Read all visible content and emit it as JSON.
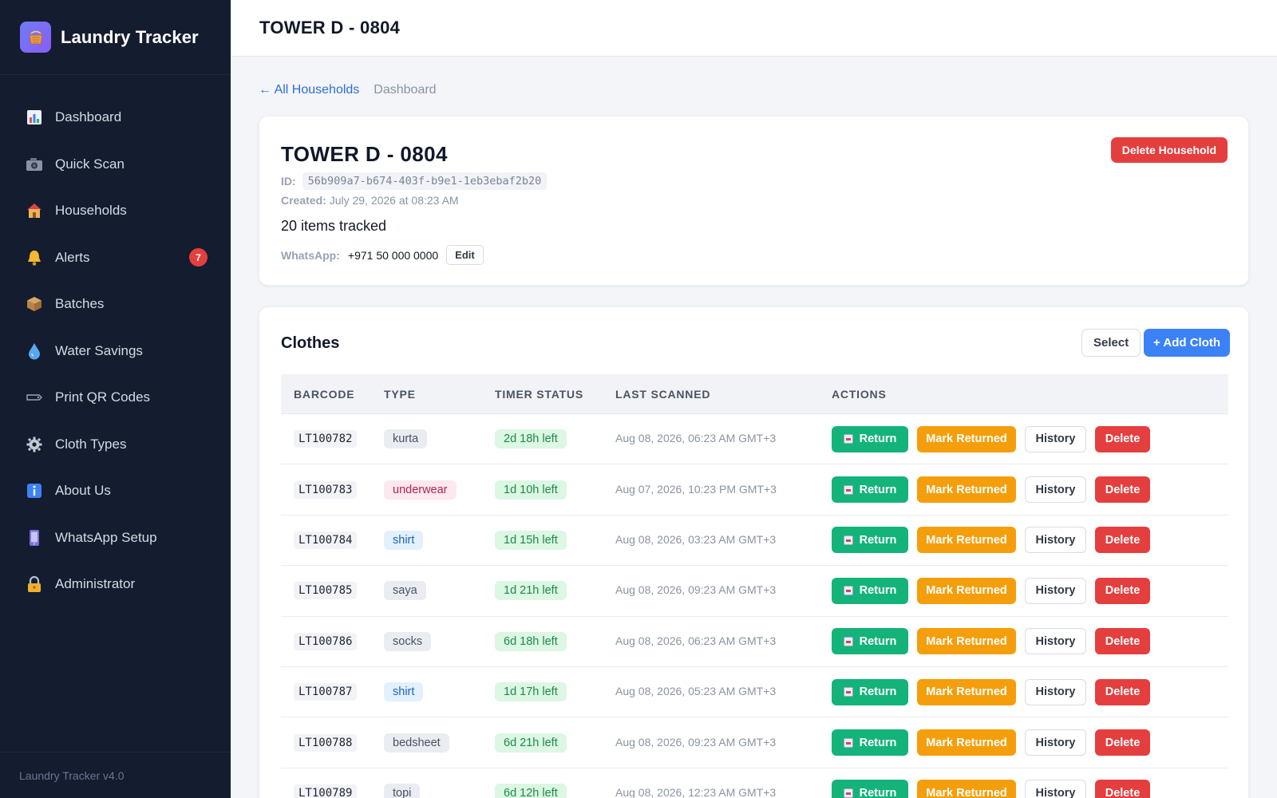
{
  "app": {
    "title": "Laundry Tracker",
    "version": "Laundry Tracker v4.0"
  },
  "sidebar": {
    "items": [
      {
        "label": "Dashboard",
        "icon": "bar-chart-icon"
      },
      {
        "label": "Quick Scan",
        "icon": "camera-icon"
      },
      {
        "label": "Households",
        "icon": "house-icon"
      },
      {
        "label": "Alerts",
        "icon": "bell-icon",
        "badge": "7"
      },
      {
        "label": "Batches",
        "icon": "package-icon"
      },
      {
        "label": "Water Savings",
        "icon": "water-drop-icon"
      },
      {
        "label": "Print QR Codes",
        "icon": "tag-icon"
      },
      {
        "label": "Cloth Types",
        "icon": "gear-icon"
      },
      {
        "label": "About Us",
        "icon": "info-icon"
      },
      {
        "label": "WhatsApp Setup",
        "icon": "phone-icon"
      },
      {
        "label": "Administrator",
        "icon": "lock-icon"
      }
    ]
  },
  "header": {
    "title": "TOWER D - 0804"
  },
  "breadcrumb": {
    "back": "← All Households",
    "current": "Dashboard"
  },
  "household": {
    "name": "TOWER D - 0804",
    "id_label": "ID:",
    "id": "56b909a7-b674-403f-b9e1-1eb3ebaf2b20",
    "created_label": "Created:",
    "created": "July 29, 2026 at 08:23 AM",
    "items_tracked": "20 items tracked",
    "whatsapp_label": "WhatsApp:",
    "whatsapp": "+971 50 000 0000",
    "edit_label": "Edit",
    "delete_label": "Delete Household"
  },
  "clothes": {
    "title": "Clothes",
    "select_label": "Select",
    "add_label": "+ Add Cloth",
    "columns": [
      "BARCODE",
      "TYPE",
      "TIMER STATUS",
      "LAST SCANNED",
      "ACTIONS"
    ],
    "actions": {
      "return": "Return",
      "mark_returned": "Mark Returned",
      "history": "History",
      "delete": "Delete"
    },
    "rows": [
      {
        "barcode": "LT100782",
        "type": "kurta",
        "type_style": "default",
        "timer": "2d 18h left",
        "scanned": "Aug 08, 2026, 06:23 AM GMT+3"
      },
      {
        "barcode": "LT100783",
        "type": "underwear",
        "type_style": "underwear",
        "timer": "1d 10h left",
        "scanned": "Aug 07, 2026, 10:23 PM GMT+3"
      },
      {
        "barcode": "LT100784",
        "type": "shirt",
        "type_style": "shirt",
        "timer": "1d 15h left",
        "scanned": "Aug 08, 2026, 03:23 AM GMT+3"
      },
      {
        "barcode": "LT100785",
        "type": "saya",
        "type_style": "default",
        "timer": "1d 21h left",
        "scanned": "Aug 08, 2026, 09:23 AM GMT+3"
      },
      {
        "barcode": "LT100786",
        "type": "socks",
        "type_style": "default",
        "timer": "6d 18h left",
        "scanned": "Aug 08, 2026, 06:23 AM GMT+3"
      },
      {
        "barcode": "LT100787",
        "type": "shirt",
        "type_style": "shirt",
        "timer": "1d 17h left",
        "scanned": "Aug 08, 2026, 05:23 AM GMT+3"
      },
      {
        "barcode": "LT100788",
        "type": "bedsheet",
        "type_style": "default",
        "timer": "6d 21h left",
        "scanned": "Aug 08, 2026, 09:23 AM GMT+3"
      },
      {
        "barcode": "LT100789",
        "type": "topi",
        "type_style": "default",
        "timer": "6d 12h left",
        "scanned": "Aug 08, 2026, 12:23 AM GMT+3"
      }
    ]
  },
  "colors": {
    "sidebar_bg": "#141c2f",
    "primary": "#3b82f6",
    "success": "#13b37a",
    "warning": "#f59e0b",
    "danger": "#e53e3e"
  }
}
